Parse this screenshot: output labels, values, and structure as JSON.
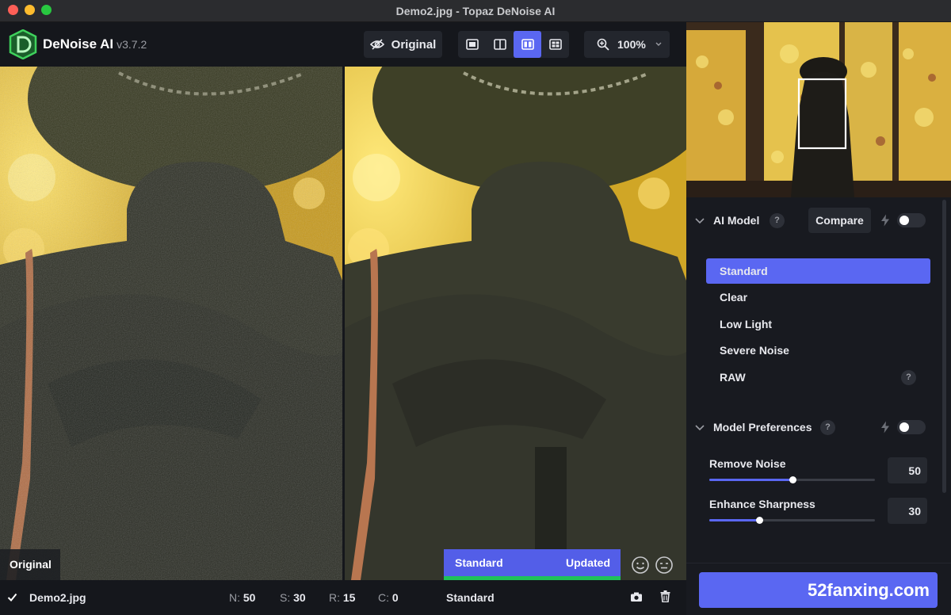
{
  "window": {
    "title": "Demo2.jpg - Topaz DeNoise AI"
  },
  "toolbar": {
    "app_name": "DeNoise AI",
    "version": "v3.7.2",
    "original_label": "Original",
    "zoom_value": "100%"
  },
  "canvas": {
    "left_label": "Original",
    "status_model": "Standard",
    "status_text": "Updated",
    "progress_fraction": 1.0
  },
  "bottom": {
    "filename": "Demo2.jpg",
    "n_key": "N:",
    "n_val": "50",
    "s_key": "S:",
    "s_val": "30",
    "r_key": "R:",
    "r_val": "15",
    "c_key": "C:",
    "c_val": "0",
    "model": "Standard"
  },
  "ai_model": {
    "title": "AI Model",
    "help": "?",
    "compare_label": "Compare",
    "models": [
      "Standard",
      "Clear",
      "Low Light",
      "Severe Noise",
      "RAW"
    ],
    "selected": "Standard",
    "raw_help": "?"
  },
  "preferences": {
    "title": "Model Preferences",
    "help": "?",
    "sliders": [
      {
        "label": "Remove Noise",
        "value": 50,
        "display": "50",
        "min": 0,
        "max": 100
      },
      {
        "label": "Enhance Sharpness",
        "value": 30,
        "display": "30",
        "min": 0,
        "max": 100
      }
    ]
  },
  "watermark": "52fanxing.com",
  "colors": {
    "accent": "#5a67f2",
    "progress": "#1fc15a",
    "panel": "#181a20"
  }
}
